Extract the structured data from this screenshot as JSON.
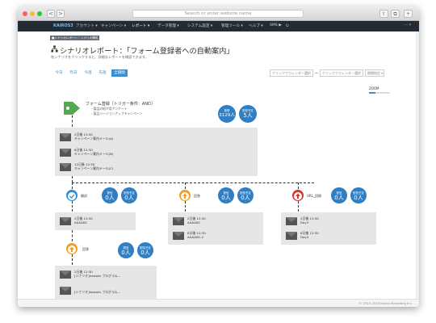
{
  "browser": {
    "url_placeholder": "Search or enter website name",
    "back": "<",
    "forward": ">",
    "share": "⇧",
    "tabs": "⧉",
    "add": "+"
  },
  "nav": {
    "logo": "KAIROS3",
    "items": [
      "アカウント ▾",
      "キャンペーン ▾",
      "レポート ▾",
      "データ管理 ▾",
      "システム設定 ▾",
      "管理ツール ▾",
      "ヘルプ ▾",
      "SMS ▶"
    ],
    "user": "— ▾"
  },
  "page": {
    "breadcrumb": "■シナリオレポート｜シナリオ構成",
    "title": "シナリオレポート：「フォーム登録者への自動案内」",
    "subtitle": "各シナリオをクリックすると、詳細なレポートを確認できます。",
    "tabs": [
      "今日",
      "昨日",
      "今週",
      "先週",
      "全期間"
    ],
    "active_tab_index": 4,
    "select_start": "クリックでカレンダー選択",
    "select_end": "クリックでカレンダー選択",
    "range_sep": "〜",
    "period_button": "期間指定 ▾",
    "zoom_label": "ZOOM",
    "zoom_level": 0.3
  },
  "trigger": {
    "title": "フォーム登録［トリガー条件：AND］",
    "items": [
      "・製品の紹介用アンケート",
      "・製品バージョンアップキャンペーン"
    ],
    "registered_label": "登録",
    "registered_value": "3129人",
    "scheduled_label": "配信予定",
    "scheduled_value": "5人"
  },
  "main_mails": [
    {
      "line1": "2日後 12:30",
      "line2": "キャンペーン案内メール(A)"
    },
    {
      "line1": "6日後 12:30",
      "line2": "キャンペーン案内メール(B)"
    },
    {
      "line1": "12日後 12:30",
      "line2": "キャンペーン案内メール(C)"
    }
  ],
  "branches": [
    {
      "label": "開封",
      "icon": "check-icon",
      "color": "#2f8fd6",
      "c1_label": "配信",
      "c1_value": "0人",
      "c2_label": "配信予定",
      "c2_value": "0人",
      "mails": [
        {
          "line1": "2日後 12:30",
          "line2": "AAAABC"
        }
      ]
    },
    {
      "label": "回答",
      "icon": "up-arrow-icon",
      "color": "#f0a020",
      "c1_label": "配信",
      "c1_value": "0人",
      "c2_label": "配信予定",
      "c2_value": "0人",
      "mails": [
        {
          "line1": "2日後 12:30",
          "line2": "AAAABC"
        },
        {
          "line1": "6日後 12:30",
          "line2": "AAAABC-2"
        }
      ]
    },
    {
      "label": "URL_回帰",
      "icon": "up-arrow-icon",
      "color": "#d8362d",
      "c1_label": "配信",
      "c1_value": "0人",
      "c2_label": "配信予定",
      "c2_value": "0人",
      "mails": [
        {
          "line1": "2日後 12:30",
          "line2": "Day3"
        },
        {
          "line1": "6日後 12:30",
          "line2": "Day4"
        }
      ]
    }
  ],
  "sub_branch": {
    "label": "回答",
    "icon": "up-arrow-icon",
    "color": "#f0a020",
    "c1_label": "配信",
    "c1_value": "0人",
    "c2_label": "配信予定",
    "c2_value": "0人",
    "mails": [
      {
        "line1": "2日後 12:30",
        "line2": "[シナリオ]hawaiis プログラム..."
      },
      {
        "line1": "",
        "line2": "[シナリオ]hawaiis プログラム..."
      }
    ]
  },
  "footer": {
    "copyright": "© 2015-2018 Kairos Marketing Inc."
  }
}
